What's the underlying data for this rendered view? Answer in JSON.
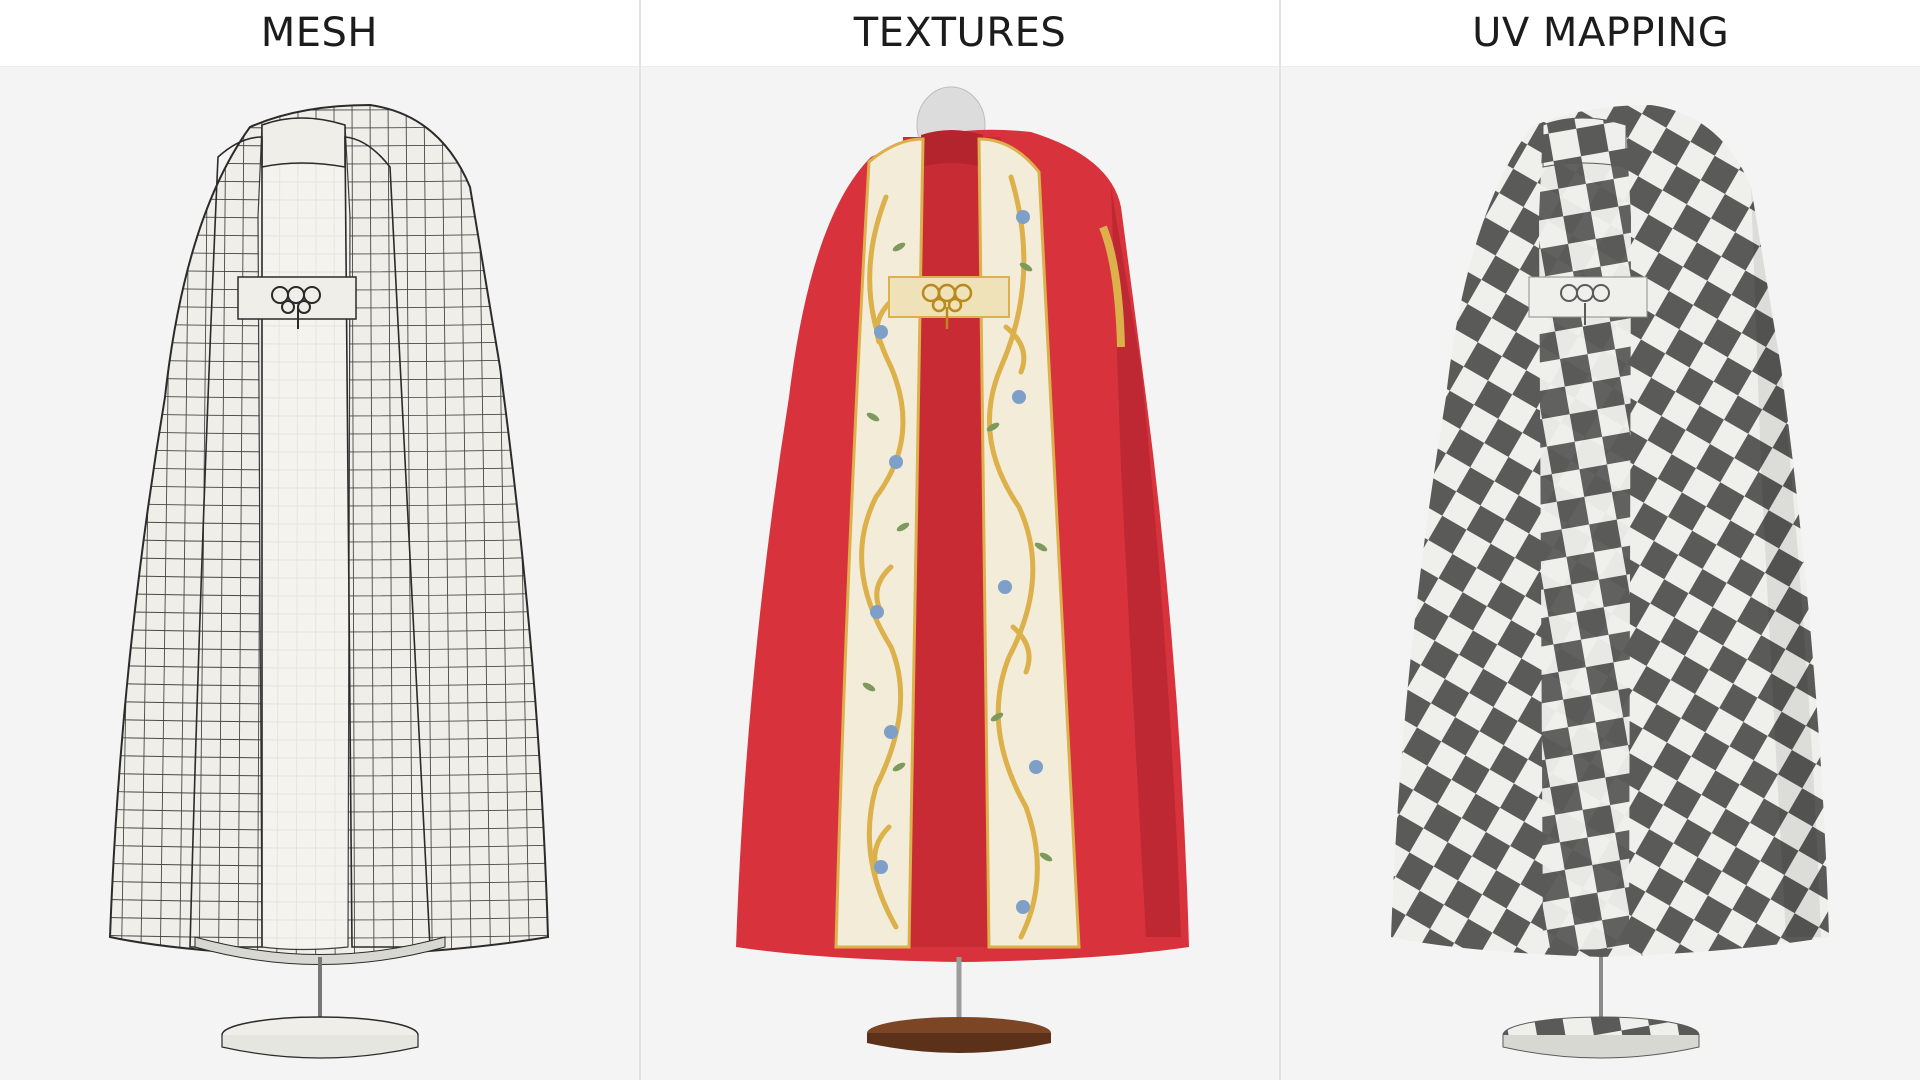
{
  "panels": [
    {
      "title": "MESH"
    },
    {
      "title": "TEXTURES"
    },
    {
      "title": "UV MAPPING"
    }
  ],
  "colors": {
    "background": "#f4f4f4",
    "header_bg": "#ffffff",
    "wire_line": "#2b2b2b",
    "cloth_white": "#efeee8",
    "red": "#d8333d",
    "ivory": "#f3ecd8",
    "gold": "#dcb04a",
    "leaf_green": "#7d9a5c",
    "flower_blue": "#7d9fc8",
    "checker_dark": "#5a5a58",
    "wood_base": "#6a3a20"
  },
  "icons": [
    "wireframe-cope-render",
    "textured-cope-render",
    "uv-checker-cope-render"
  ]
}
